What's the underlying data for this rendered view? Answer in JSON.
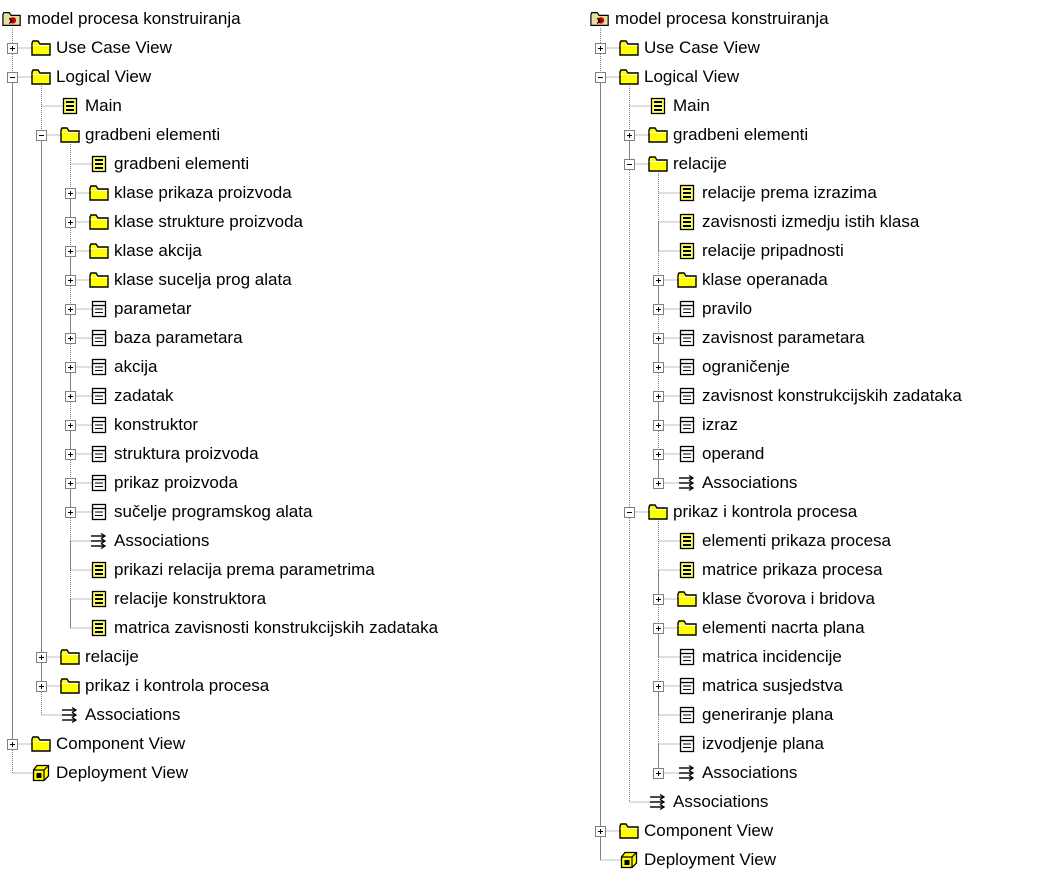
{
  "left_tree": {
    "items": [
      {
        "label": "model procesa konstruiranja",
        "level": 0,
        "icon": "model-icon",
        "expander": "none",
        "last": true
      },
      {
        "label": "Use Case View",
        "level": 1,
        "icon": "folder-icon",
        "expander": "plus",
        "last": false
      },
      {
        "label": "Logical View",
        "level": 1,
        "icon": "folder-icon",
        "expander": "minus",
        "last": false
      },
      {
        "label": "Main",
        "level": 2,
        "icon": "diagram-icon",
        "expander": "none",
        "last": false
      },
      {
        "label": "gradbeni elementi",
        "level": 2,
        "icon": "folder-icon",
        "expander": "minus",
        "last": false
      },
      {
        "label": "gradbeni elementi",
        "level": 3,
        "icon": "diagram-icon",
        "expander": "none",
        "last": false
      },
      {
        "label": "klase prikaza proizvoda",
        "level": 3,
        "icon": "folder-icon",
        "expander": "plus",
        "last": false
      },
      {
        "label": "klase strukture proizvoda",
        "level": 3,
        "icon": "folder-icon",
        "expander": "plus",
        "last": false
      },
      {
        "label": "klase akcija",
        "level": 3,
        "icon": "folder-icon",
        "expander": "plus",
        "last": false
      },
      {
        "label": "klase sucelja prog alata",
        "level": 3,
        "icon": "folder-icon",
        "expander": "plus",
        "last": false
      },
      {
        "label": "parametar",
        "level": 3,
        "icon": "class-icon",
        "expander": "plus",
        "last": false
      },
      {
        "label": "baza parametara",
        "level": 3,
        "icon": "class-icon",
        "expander": "plus",
        "last": false
      },
      {
        "label": "akcija",
        "level": 3,
        "icon": "class-icon",
        "expander": "plus",
        "last": false
      },
      {
        "label": "zadatak",
        "level": 3,
        "icon": "class-icon",
        "expander": "plus",
        "last": false
      },
      {
        "label": "konstruktor",
        "level": 3,
        "icon": "class-icon",
        "expander": "plus",
        "last": false
      },
      {
        "label": "struktura proizvoda",
        "level": 3,
        "icon": "class-icon",
        "expander": "plus",
        "last": false
      },
      {
        "label": "prikaz proizvoda",
        "level": 3,
        "icon": "class-icon",
        "expander": "plus",
        "last": false
      },
      {
        "label": "sučelje programskog alata",
        "level": 3,
        "icon": "class-icon",
        "expander": "plus",
        "last": false
      },
      {
        "label": "Associations",
        "level": 3,
        "icon": "associations-icon",
        "expander": "none",
        "last": false
      },
      {
        "label": "prikazi relacija prema parametrima",
        "level": 3,
        "icon": "diagram-icon",
        "expander": "none",
        "last": false
      },
      {
        "label": "relacije konstruktora",
        "level": 3,
        "icon": "diagram-icon",
        "expander": "none",
        "last": false
      },
      {
        "label": "matrica zavisnosti konstrukcijskih zadataka",
        "level": 3,
        "icon": "diagram-icon",
        "expander": "none",
        "last": true
      },
      {
        "label": "relacije",
        "level": 2,
        "icon": "folder-icon",
        "expander": "plus",
        "last": false
      },
      {
        "label": "prikaz i kontrola procesa",
        "level": 2,
        "icon": "folder-icon",
        "expander": "plus",
        "last": false
      },
      {
        "label": "Associations",
        "level": 2,
        "icon": "associations-icon",
        "expander": "none",
        "last": true
      },
      {
        "label": "Component View",
        "level": 1,
        "icon": "folder-icon",
        "expander": "plus",
        "last": false
      },
      {
        "label": "Deployment View",
        "level": 1,
        "icon": "deployment-icon",
        "expander": "none",
        "last": true
      }
    ]
  },
  "right_tree": {
    "items": [
      {
        "label": "model procesa konstruiranja",
        "level": 0,
        "icon": "model-icon",
        "expander": "none",
        "last": true
      },
      {
        "label": "Use Case View",
        "level": 1,
        "icon": "folder-icon",
        "expander": "plus",
        "last": false
      },
      {
        "label": "Logical View",
        "level": 1,
        "icon": "folder-icon",
        "expander": "minus",
        "last": false
      },
      {
        "label": "Main",
        "level": 2,
        "icon": "diagram-icon",
        "expander": "none",
        "last": false
      },
      {
        "label": "gradbeni elementi",
        "level": 2,
        "icon": "folder-icon",
        "expander": "plus",
        "last": false
      },
      {
        "label": "relacije",
        "level": 2,
        "icon": "folder-icon",
        "expander": "minus",
        "last": false
      },
      {
        "label": "relacije prema izrazima",
        "level": 3,
        "icon": "diagram-icon",
        "expander": "none",
        "last": false
      },
      {
        "label": "zavisnosti izmedju istih klasa",
        "level": 3,
        "icon": "diagram-icon",
        "expander": "none",
        "last": false
      },
      {
        "label": "relacije pripadnosti",
        "level": 3,
        "icon": "diagram-icon",
        "expander": "none",
        "last": false
      },
      {
        "label": "klase operanada",
        "level": 3,
        "icon": "folder-icon",
        "expander": "plus",
        "last": false
      },
      {
        "label": "pravilo",
        "level": 3,
        "icon": "class-icon",
        "expander": "plus",
        "last": false
      },
      {
        "label": "zavisnost parametara",
        "level": 3,
        "icon": "class-icon",
        "expander": "plus",
        "last": false
      },
      {
        "label": "ograničenje",
        "level": 3,
        "icon": "class-icon",
        "expander": "plus",
        "last": false
      },
      {
        "label": "zavisnost konstrukcijskih zadataka",
        "level": 3,
        "icon": "class-icon",
        "expander": "plus",
        "last": false
      },
      {
        "label": "izraz",
        "level": 3,
        "icon": "class-icon",
        "expander": "plus",
        "last": false
      },
      {
        "label": "operand",
        "level": 3,
        "icon": "class-icon",
        "expander": "plus",
        "last": false
      },
      {
        "label": "Associations",
        "level": 3,
        "icon": "associations-icon",
        "expander": "plus",
        "last": true
      },
      {
        "label": "prikaz i kontrola procesa",
        "level": 2,
        "icon": "folder-icon",
        "expander": "minus",
        "last": false
      },
      {
        "label": "elementi prikaza procesa",
        "level": 3,
        "icon": "diagram-icon",
        "expander": "none",
        "last": false
      },
      {
        "label": "matrice prikaza procesa",
        "level": 3,
        "icon": "diagram-icon",
        "expander": "none",
        "last": false
      },
      {
        "label": "klase čvorova i bridova",
        "level": 3,
        "icon": "folder-icon",
        "expander": "plus",
        "last": false
      },
      {
        "label": "elementi nacrta plana",
        "level": 3,
        "icon": "folder-icon",
        "expander": "plus",
        "last": false
      },
      {
        "label": "matrica incidencije",
        "level": 3,
        "icon": "class-icon",
        "expander": "none",
        "last": false
      },
      {
        "label": "matrica susjedstva",
        "level": 3,
        "icon": "class-icon",
        "expander": "plus",
        "last": false
      },
      {
        "label": "generiranje plana",
        "level": 3,
        "icon": "class-icon",
        "expander": "none",
        "last": false
      },
      {
        "label": "izvodjenje plana",
        "level": 3,
        "icon": "class-icon",
        "expander": "none",
        "last": false
      },
      {
        "label": "Associations",
        "level": 3,
        "icon": "associations-icon",
        "expander": "plus",
        "last": true
      },
      {
        "label": "Associations",
        "level": 2,
        "icon": "associations-icon",
        "expander": "none",
        "last": true
      },
      {
        "label": "Component View",
        "level": 1,
        "icon": "folder-icon",
        "expander": "plus",
        "last": false
      },
      {
        "label": "Deployment View",
        "level": 1,
        "icon": "deployment-icon",
        "expander": "none",
        "last": true
      }
    ]
  },
  "colors": {
    "folder_fill": "#ffff00",
    "tree_line": "#808080",
    "text": "#000000",
    "background": "#ffffff"
  }
}
